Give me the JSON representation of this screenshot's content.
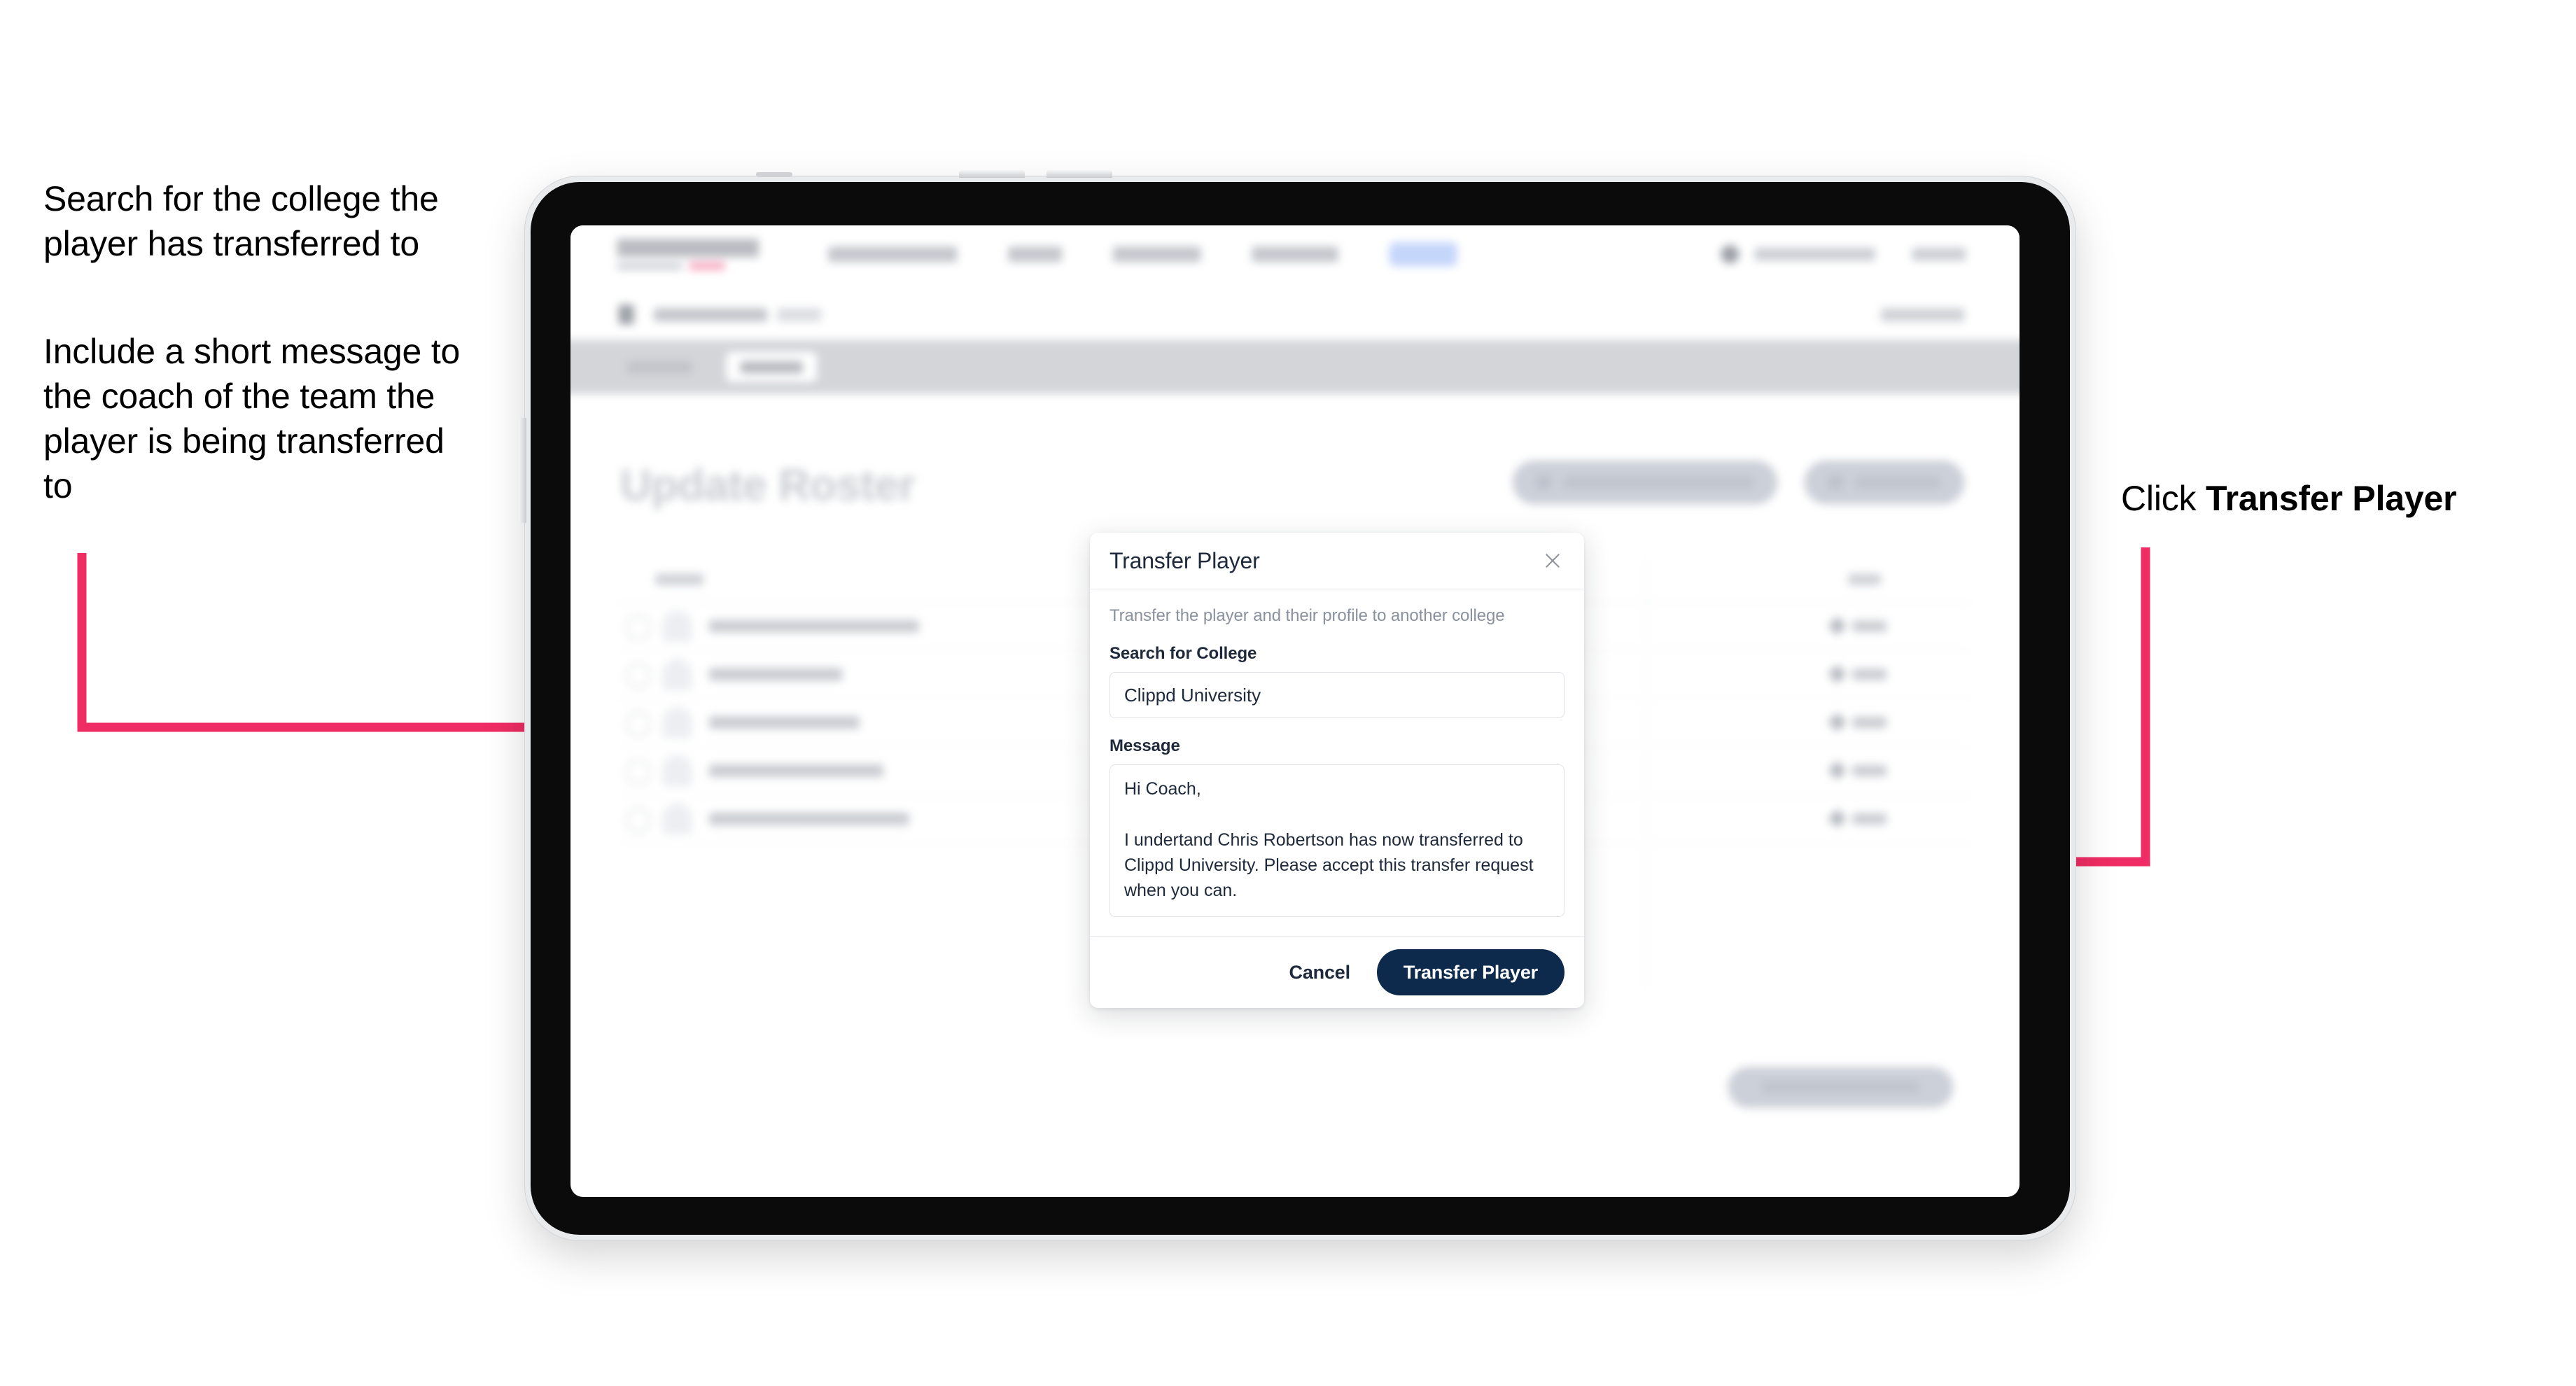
{
  "annotations": {
    "left_1": "Search for the college the player has transferred to",
    "left_2": "Include a short message to the coach of the team the player is being transferred to",
    "right_prefix": "Click ",
    "right_bold": "Transfer Player"
  },
  "colors": {
    "accent_pink": "#ef2c63",
    "primary_navy": "#0d2a4d",
    "nav_pill_blue": "#c5d6fb",
    "tabbar_grey": "#d3d5d9",
    "text_dark": "#1e2a3b",
    "text_muted": "#8a919e",
    "border": "#dfe2e8"
  },
  "app": {
    "page_title": "Update Roster"
  },
  "modal": {
    "title": "Transfer Player",
    "close_icon": "close-icon",
    "description": "Transfer the player and their profile to another college",
    "college": {
      "label": "Search for College",
      "value": "Clippd University",
      "placeholder": "Search for College"
    },
    "message": {
      "label": "Message",
      "value": "Hi Coach,\n\nI undertand Chris Robertson has now transferred to Clippd University. Please accept this transfer request when you can.",
      "placeholder": "Message"
    },
    "cancel_label": "Cancel",
    "submit_label": "Transfer Player"
  }
}
